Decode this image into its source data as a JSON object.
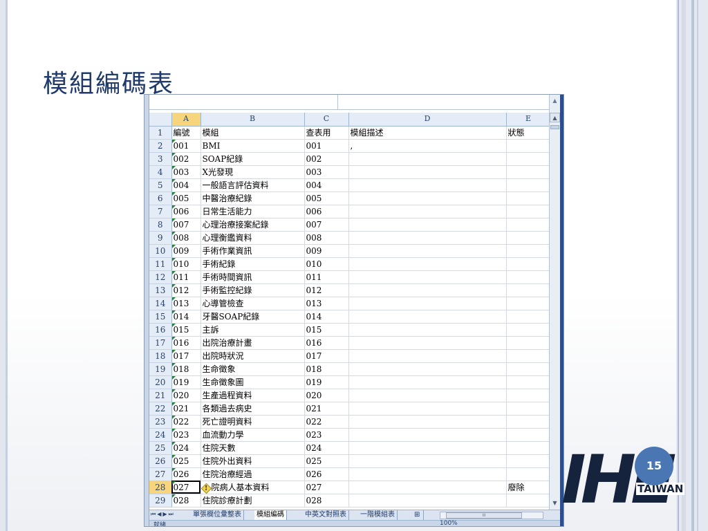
{
  "slide": {
    "title": "模組編碼表",
    "page_number": "15",
    "logo_text": "IHE",
    "logo_subtext": "TAIWAN"
  },
  "sheet": {
    "columns": [
      "A",
      "B",
      "C",
      "D",
      "E"
    ],
    "active_column": "A",
    "active_row": 28,
    "rows": [
      {
        "n": "1",
        "a": "編號",
        "b": "模組",
        "c": "查表用",
        "d": "模組描述",
        "e": "狀態"
      },
      {
        "n": "2",
        "a": "001",
        "b": "BMI",
        "c": "001",
        "d": ",",
        "e": ""
      },
      {
        "n": "3",
        "a": "002",
        "b": "SOAP紀錄",
        "c": "002",
        "d": "",
        "e": ""
      },
      {
        "n": "4",
        "a": "003",
        "b": "X光發現",
        "c": "003",
        "d": "",
        "e": ""
      },
      {
        "n": "5",
        "a": "004",
        "b": "一般語言評估資料",
        "c": "004",
        "d": "",
        "e": ""
      },
      {
        "n": "6",
        "a": "005",
        "b": "中醫治療紀錄",
        "c": "005",
        "d": "",
        "e": ""
      },
      {
        "n": "7",
        "a": "006",
        "b": "日常生活能力",
        "c": "006",
        "d": "",
        "e": ""
      },
      {
        "n": "8",
        "a": "007",
        "b": "心理治療接案紀錄",
        "c": "007",
        "d": "",
        "e": ""
      },
      {
        "n": "9",
        "a": "008",
        "b": "心理衡鑑資料",
        "c": "008",
        "d": "",
        "e": ""
      },
      {
        "n": "10",
        "a": "009",
        "b": "手術作業資訊",
        "c": "009",
        "d": "",
        "e": ""
      },
      {
        "n": "11",
        "a": "010",
        "b": "手術紀錄",
        "c": "010",
        "d": "",
        "e": ""
      },
      {
        "n": "12",
        "a": "011",
        "b": "手術時間資訊",
        "c": "011",
        "d": "",
        "e": ""
      },
      {
        "n": "13",
        "a": "012",
        "b": "手術監控紀錄",
        "c": "012",
        "d": "",
        "e": ""
      },
      {
        "n": "14",
        "a": "013",
        "b": "心導管檢查",
        "c": "013",
        "d": "",
        "e": ""
      },
      {
        "n": "15",
        "a": "014",
        "b": "牙醫SOAP紀錄",
        "c": "014",
        "d": "",
        "e": ""
      },
      {
        "n": "16",
        "a": "015",
        "b": "主訴",
        "c": "015",
        "d": "",
        "e": ""
      },
      {
        "n": "17",
        "a": "016",
        "b": "出院治療計畫",
        "c": "016",
        "d": "",
        "e": ""
      },
      {
        "n": "18",
        "a": "017",
        "b": "出院時狀況",
        "c": "017",
        "d": "",
        "e": ""
      },
      {
        "n": "19",
        "a": "018",
        "b": "生命徵象",
        "c": "018",
        "d": "",
        "e": ""
      },
      {
        "n": "20",
        "a": "019",
        "b": "生命徵象圖",
        "c": "019",
        "d": "",
        "e": ""
      },
      {
        "n": "21",
        "a": "020",
        "b": "生產過程資料",
        "c": "020",
        "d": "",
        "e": ""
      },
      {
        "n": "22",
        "a": "021",
        "b": "各類過去病史",
        "c": "021",
        "d": "",
        "e": ""
      },
      {
        "n": "23",
        "a": "022",
        "b": "死亡證明資料",
        "c": "022",
        "d": "",
        "e": ""
      },
      {
        "n": "24",
        "a": "023",
        "b": "血流動力學",
        "c": "023",
        "d": "",
        "e": ""
      },
      {
        "n": "25",
        "a": "024",
        "b": "住院天數",
        "c": "024",
        "d": "",
        "e": ""
      },
      {
        "n": "26",
        "a": "025",
        "b": "住院外出資料",
        "c": "025",
        "d": "",
        "e": ""
      },
      {
        "n": "27",
        "a": "026",
        "b": "住院治療經過",
        "c": "026",
        "d": "",
        "e": ""
      },
      {
        "n": "28",
        "a": "027",
        "b": "院病人基本資料",
        "c": "027",
        "d": "",
        "e": "廢除"
      },
      {
        "n": "29",
        "a": "028",
        "b": "住院診療計劃",
        "c": "028",
        "d": "",
        "e": ""
      }
    ],
    "tabs": [
      "單張欄位彙整表",
      "模組編碼",
      "中英文對照表",
      "一階模組表"
    ],
    "active_tab": "模組編碼",
    "status_ready": "就緒",
    "zoom": "100%",
    "scroll_glyph": "III"
  },
  "icons": {
    "warning": "warning-diamond-icon",
    "scroll_up": "scroll-up-icon",
    "scroll_down": "scroll-down-icon"
  },
  "colors": {
    "title": "#1f3a6b",
    "header_bg": "#e4ecf7",
    "active_header": "#f7d57c",
    "badge": "#4a77b4"
  }
}
